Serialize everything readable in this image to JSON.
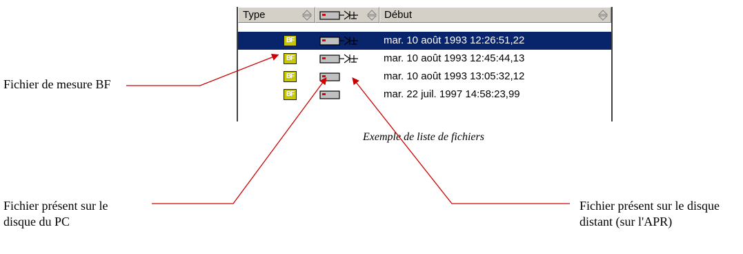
{
  "file_list": {
    "columns": {
      "type": "Type",
      "start": "Début"
    },
    "rows": [
      {
        "type_badge": "BF",
        "location": "pc-and-remote",
        "start": "mar. 10 août  1993 12:26:51,22",
        "selected": true
      },
      {
        "type_badge": "BF",
        "location": "pc-and-remote",
        "start": "mar. 10 août  1993 12:45:44,13",
        "selected": false
      },
      {
        "type_badge": "BF",
        "location": "pc",
        "start": "mar. 10 août  1993 13:05:32,12",
        "selected": false
      },
      {
        "type_badge": "BF",
        "location": "pc",
        "start": "mar. 22 juil. 1997 14:58:23,99",
        "selected": false
      }
    ]
  },
  "caption": "Exemple de liste de fichiers",
  "annotations": {
    "bf_file": "Fichier de mesure BF",
    "pc_disk": "Fichier présent sur le disque du PC",
    "remote_disk": "Fichier présent sur le disque distant (sur l'APR)"
  },
  "colors": {
    "selection": "#08246b",
    "arrow": "#cc0000",
    "header": "#d4d0c8",
    "bf_badge": "#c8c800"
  }
}
